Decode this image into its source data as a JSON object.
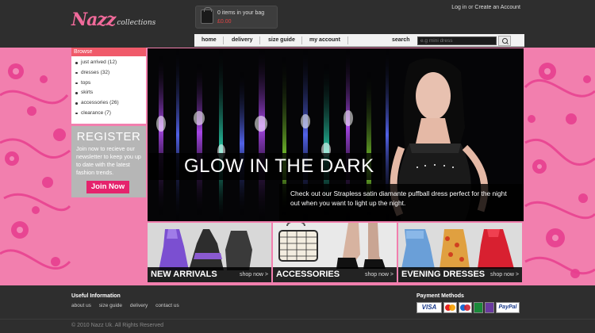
{
  "brand": {
    "logo_main": "Nazz",
    "logo_sub": "collections"
  },
  "bag": {
    "count_text": "0 items in your bag",
    "total": "£0.00"
  },
  "account": {
    "login": "Log in",
    "or": "or",
    "create": "Create an Account"
  },
  "nav": {
    "items": [
      {
        "label": "home"
      },
      {
        "label": "delivery"
      },
      {
        "label": "size guide"
      },
      {
        "label": "my account"
      }
    ],
    "search_label": "search",
    "search_placeholder": "e.g mini dress"
  },
  "browse": {
    "title": "Browse",
    "items": [
      {
        "label": "just arrived (12)"
      },
      {
        "label": "dresses  (32)"
      },
      {
        "label": "tops"
      },
      {
        "label": "skirts"
      },
      {
        "label": "accessories  (26)"
      },
      {
        "label": "clearance (7)"
      }
    ]
  },
  "register": {
    "title": "REGISTER",
    "text": "Join now to recieve our newsletter to keep you up to date with the latest fashion trends.",
    "button": "Join Now"
  },
  "hero": {
    "title": "GLOW IN THE DARK",
    "text": "Check out our Strapless satin diamante puffball dress perfect for the night out when you want to light up the night."
  },
  "tiles": [
    {
      "label": "NEW ARRIVALS",
      "shop": "shop now >"
    },
    {
      "label": "ACCESSORIES",
      "shop": "shop now >"
    },
    {
      "label": "EVENING DRESSES",
      "shop": "shop now >"
    }
  ],
  "footer": {
    "useful_title": "Useful Information",
    "links": [
      {
        "label": "about us"
      },
      {
        "label": "size guide"
      },
      {
        "label": "delivery"
      },
      {
        "label": "contact us"
      }
    ],
    "payment_title": "Payment Methods",
    "cards": [
      {
        "label": "VISA"
      },
      {
        "label": "mastercard-icon"
      },
      {
        "label": "maestro-icon"
      },
      {
        "label": "solo-icon"
      },
      {
        "label": "switch-icon"
      },
      {
        "label": "PayPal"
      }
    ],
    "copyright": "© 2010 Nazz Uk. All Rights Reserved"
  },
  "colors": {
    "accent_pink": "#e5236d",
    "browse_header": "#f05a6a",
    "floral_bg": "#f27fae"
  }
}
